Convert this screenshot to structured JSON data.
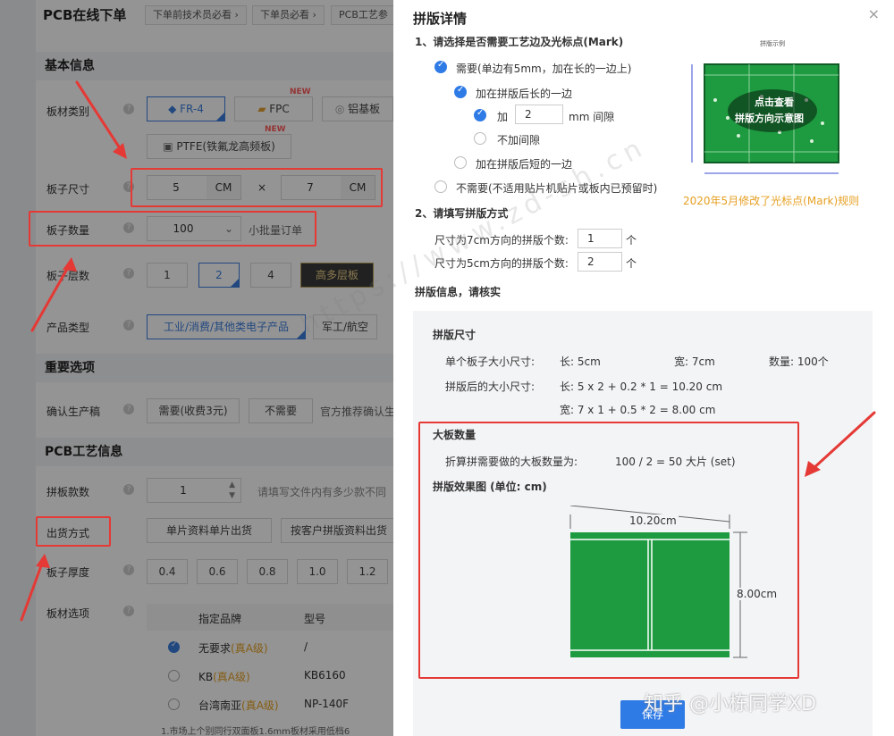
{
  "left_form": {
    "title": "PCB在线下单",
    "crumbs": [
      "下单前技术员必看 ›",
      "下单员必看 ›",
      "PCB工艺参"
    ],
    "sections": {
      "basic": "基本信息",
      "important": "重要选项",
      "process": "PCB工艺信息"
    },
    "labels": {
      "material": "板材类别",
      "size": "板子尺寸",
      "quantity": "板子数量",
      "layers": "板子层数",
      "product": "产品类型",
      "confirm": "确认生产稿",
      "panel_count": "拼板款数",
      "shipping": "出货方式",
      "thickness": "板子厚度",
      "material_opt": "板材选项"
    },
    "material_options": [
      "FR-4",
      "FPC",
      "铝基板",
      "PTFE(铁氟龙高频板)"
    ],
    "new_badge": "NEW",
    "size": {
      "length": "5",
      "width": "7",
      "unit": "CM",
      "times": "×"
    },
    "quantity": {
      "value": "100",
      "hint": "小批量订单"
    },
    "layers": [
      "1",
      "2",
      "4",
      "高多层板"
    ],
    "product_types": [
      "工业/消费/其他类电子产品",
      "军工/航空"
    ],
    "confirm_options": [
      "需要(收费3元)",
      "不需要",
      "官方推荐确认生"
    ],
    "panel_count": {
      "value": "1",
      "hint": "请填写文件内有多少款不同"
    },
    "shipping_options": [
      "单片资料单片出货",
      "按客户拼版资料出货"
    ],
    "thickness": [
      "0.4",
      "0.6",
      "0.8",
      "1.0",
      "1.2"
    ],
    "material_table": {
      "headers": [
        "指定品牌",
        "型号"
      ],
      "rows": [
        {
          "brand": "无要求",
          "grade": "(真A级)",
          "model": "/"
        },
        {
          "brand": "KB",
          "grade": "(真A级)",
          "model": "KB6160"
        },
        {
          "brand": "台湾南亚",
          "grade": "(真A级)",
          "model": "NP-140F"
        }
      ],
      "note": "1.市场上个别同行双面板1.6mm板材采用低档6"
    }
  },
  "modal": {
    "title": "拼版详情",
    "close": "×",
    "q1": "1、请选择是否需要工艺边及光标点(Mark)",
    "opt_need": "需要(单边有5mm，加在长的一边上)",
    "opt_long": "加在拼版后长的一边",
    "opt_add": "加",
    "gap_value": "2",
    "gap_unit": "mm 间隙",
    "opt_nogap": "不加间隙",
    "opt_short": "加在拼版后短的一边",
    "opt_noneed": "不需要(不适用贴片机贴片或板内已预留时)",
    "q2": "2、请填写拼版方式",
    "dir7_label": "尺寸为7cm方向的拼版个数:",
    "dir7_value": "1",
    "dir5_label": "尺寸为5cm方向的拼版个数:",
    "dir5_value": "2",
    "piece_unit": "个",
    "check_note": "拼版信息，请核实",
    "thumb_title": "拼版示例",
    "thumb_overlay_1": "点击查看",
    "thumb_overlay_2": "拼版方向示意图",
    "mark_notice": "2020年5月修改了光标点(Mark)规则",
    "info": {
      "size_title": "拼版尺寸",
      "single_label": "单个板子大小尺寸:",
      "single_len": "长: 5cm",
      "single_wid": "宽: 7cm",
      "single_qty": "数量: 100个",
      "after_label": "拼版后的大小尺寸:",
      "after_len": "长: 5 x 2 + 0.2 * 1 = 10.20 cm",
      "after_wid": "宽: 7 x 1 + 0.5 * 2 = 8.00 cm",
      "big_title": "大板数量",
      "big_label": "折算拼需要做的大板数量为:",
      "big_value": "100 / 2 = 50 大片 (set)",
      "effect_title": "拼版效果图 (单位: cm)",
      "dim_w": "10.20cm",
      "dim_h": "8.00cm"
    },
    "save": "保存"
  },
  "watermarks": {
    "zhihu": "知乎 @小栋同学XD",
    "site": "https://www.zd-sh.cn"
  },
  "colors": {
    "accent": "#2f7be6",
    "highlight": "#e53935",
    "pcb_green": "#1e9b40",
    "notice": "#e6a023"
  }
}
